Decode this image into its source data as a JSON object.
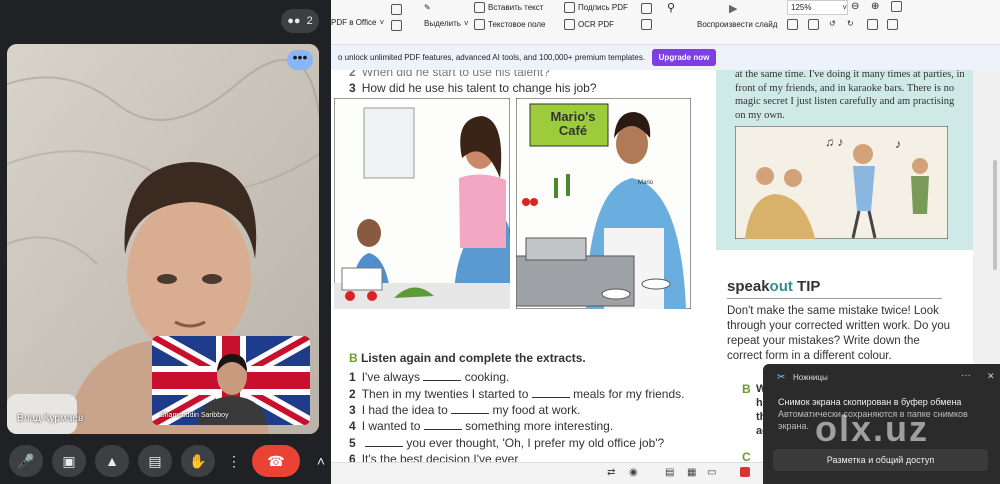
{
  "meet": {
    "participant_count": "2",
    "main_name": "Влад Курмаев",
    "pip_name": "Shamsuddin Saribboy",
    "more_label": "•••"
  },
  "toolbar": {
    "pdf_office": "PDF в Office",
    "select": "Выделить",
    "insert_text": "Вставить текст",
    "text_field": "Текстовое поле",
    "sign_pdf": "Подпись PDF",
    "ocr_pdf": "OCR PDF",
    "play_slide": "Воспроизвести слайд",
    "zoom": "125%"
  },
  "banner": {
    "text": "o unlock unlimited PDF features, advanced AI tools, and 100,000+ premium templates.",
    "upgrade": "Upgrade now"
  },
  "page": {
    "q2_fragment": "When did he start to use his talent?",
    "q3_num": "3",
    "q3": "How did he use his talent to change his job?",
    "cafe_sign": "Mario's Café",
    "apron_name": "Mario",
    "section_b_letter": "B",
    "section_b_title": "Listen again and complete the extracts.",
    "items": [
      {
        "n": "1",
        "before": "I've always",
        "after": "cooking."
      },
      {
        "n": "2",
        "before": "Then in my twenties I started to",
        "after": "meals for my friends."
      },
      {
        "n": "3",
        "before": "I had the idea to",
        "after": "my food at work."
      },
      {
        "n": "4",
        "before": "I wanted to",
        "after": "something more interesting."
      },
      {
        "n": "5",
        "before": "",
        "after": "you ever thought, 'Oh, I prefer my old office job'?"
      },
      {
        "n": "6",
        "before": "It's the best decision I've ever",
        "after": ""
      }
    ],
    "teal_text": "at the same time. I've doing it many times at parties, in front of my friends, and in karaoke bars. There is no magic secret I just listen carefully and am practising on my own.",
    "tip_speak": "speak",
    "tip_out": "out",
    "tip_word": "TIP",
    "tip_body": "Don't make the same mistake twice! Look through your corrected written work. Do you repeat your mistakes? Write down the correct form in a different colour.",
    "c_letter_b": "B",
    "c_letter_c": "C",
    "side_words": [
      "W",
      "hidd",
      "think",
      "actor"
    ]
  },
  "toast": {
    "app": "Ножницы",
    "title": "Снимок экрана скопирован в буфер обмена",
    "sub": "Автоматически сохраняются в папке снимков экрана.",
    "action": "Разметка и общий доступ",
    "dots": "···",
    "close": "✕"
  },
  "watermark": "olx.uz",
  "colors": {
    "end_call": "#ea4335",
    "upgrade": "#7b3fe4",
    "teal_box": "#cfe9e6",
    "section_green": "#6a9c2d"
  }
}
